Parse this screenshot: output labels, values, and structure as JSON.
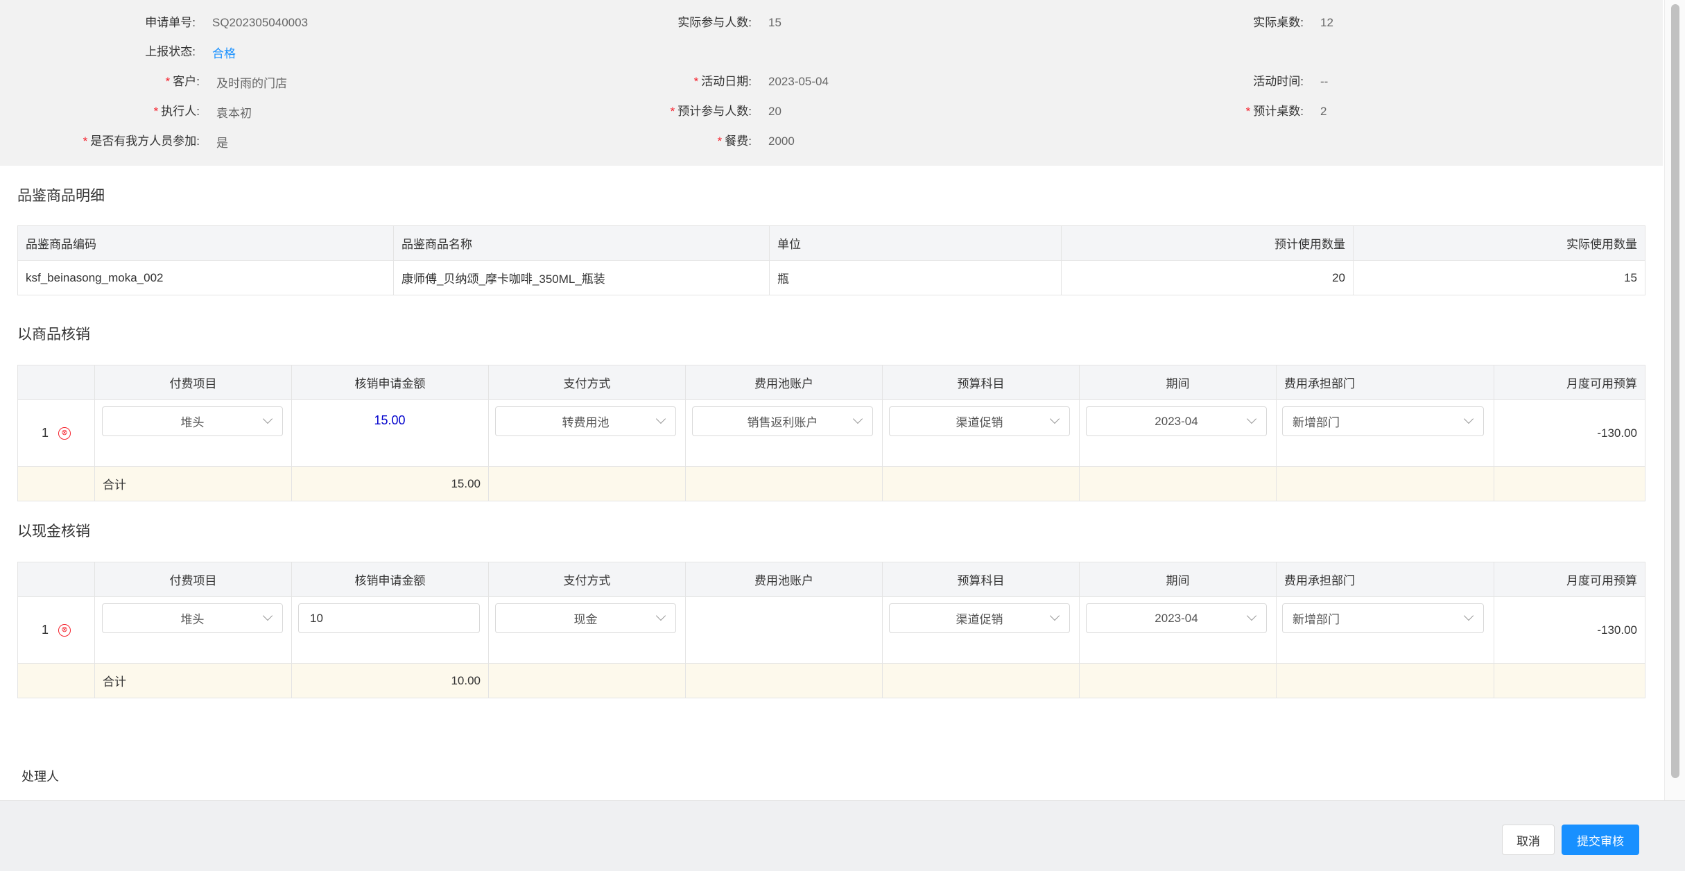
{
  "info": {
    "apply_no": {
      "label": "申请单号:",
      "value": "SQ202305040003"
    },
    "actual_people": {
      "label": "实际参与人数:",
      "value": "15"
    },
    "actual_tables": {
      "label": "实际桌数:",
      "value": "12"
    },
    "report_status": {
      "label": "上报状态:",
      "value": "合格"
    },
    "customer": {
      "label": "客户:",
      "value": "及时雨的门店"
    },
    "activity_date": {
      "label": "活动日期:",
      "value": "2023-05-04"
    },
    "activity_time": {
      "label": "活动时间:",
      "value": "--"
    },
    "executor": {
      "label": "执行人:",
      "value": "袁本初"
    },
    "planned_people": {
      "label": "预计参与人数:",
      "value": "20"
    },
    "planned_tables": {
      "label": "预计桌数:",
      "value": "2"
    },
    "our_staff": {
      "label": "是否有我方人员参加:",
      "value": "是"
    },
    "meal_fee": {
      "label": "餐费:",
      "value": "2000"
    },
    "required_mark": "*"
  },
  "tasting": {
    "title": "品鉴商品明细",
    "headers": [
      "品鉴商品编码",
      "品鉴商品名称",
      "单位",
      "预计使用数量",
      "实际使用数量"
    ],
    "rows": [
      [
        "ksf_beinasong_moka_002",
        "康师傅_贝纳颂_摩卡咖啡_350ML_瓶装",
        "瓶",
        "20",
        "15"
      ]
    ]
  },
  "goods": {
    "title": "以商品核销",
    "headers": [
      "",
      "付费项目",
      "核销申请金额",
      "支付方式",
      "费用池账户",
      "预算科目",
      "期间",
      "费用承担部门",
      "月度可用预算"
    ],
    "row": {
      "index": "1",
      "delete_icon": "⊗",
      "pay_item": "堆头",
      "amount": "15.00",
      "pay_method": "转费用池",
      "pool_account": "销售返利账户",
      "budget_subject": "渠道促销",
      "period": "2023-04",
      "department": "新增部门",
      "monthly_budget": "-130.00"
    },
    "total": {
      "label": "合计",
      "amount": "15.00"
    }
  },
  "cash": {
    "title": "以现金核销",
    "headers": [
      "",
      "付费项目",
      "核销申请金额",
      "支付方式",
      "费用池账户",
      "预算科目",
      "期间",
      "费用承担部门",
      "月度可用预算"
    ],
    "row": {
      "index": "1",
      "delete_icon": "⊗",
      "pay_item": "堆头",
      "amount": "10",
      "pay_method": "现金",
      "budget_subject": "渠道促销",
      "period": "2023-04",
      "department": "新增部门",
      "monthly_budget": "-130.00"
    },
    "total": {
      "label": "合计",
      "amount": "10.00"
    }
  },
  "handler_label": "处理人",
  "footer": {
    "cancel": "取消",
    "submit": "提交审核"
  },
  "colors": {
    "accent": "#1890ff",
    "required": "#f5222d",
    "sum_bg": "#fdf9ec"
  }
}
